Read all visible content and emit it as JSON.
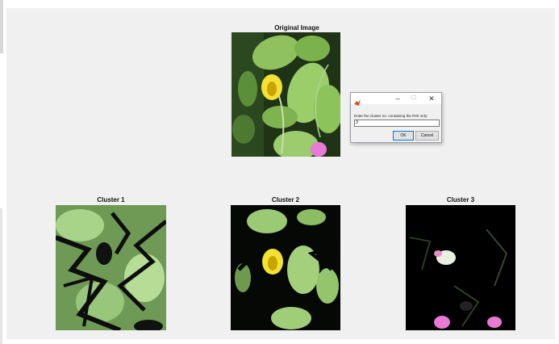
{
  "figure": {
    "plots": [
      {
        "title": "Original Image"
      },
      {
        "title": "Cluster 1"
      },
      {
        "title": "Cluster 2"
      },
      {
        "title": "Cluster 3"
      }
    ]
  },
  "dialog": {
    "icon": "matlab-icon",
    "minimize_glyph": "–",
    "maximize_glyph": "☐",
    "close_glyph": "✕",
    "prompt": "Enter the cluster no. containing the ROI only:",
    "input_value": "3",
    "ok_label": "OK",
    "cancel_label": "Cancel"
  }
}
